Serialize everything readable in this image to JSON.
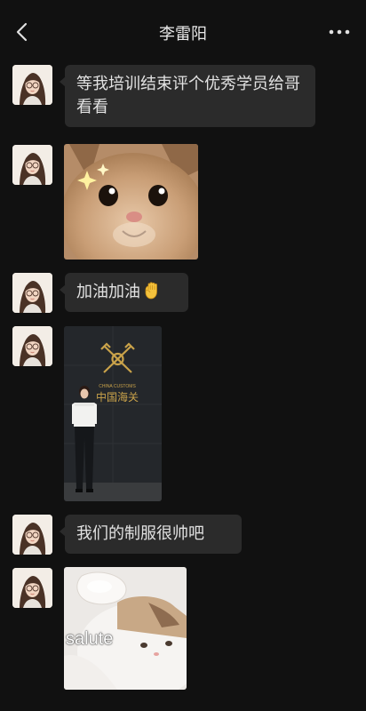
{
  "header": {
    "title": "李雷阳",
    "back_icon": "chevron-left-icon",
    "more_icon": "more-horizontal-icon"
  },
  "messages": [
    {
      "type": "text",
      "sender": "contact",
      "text": "等我培训结束评个优秀学员给哥看看"
    },
    {
      "type": "image",
      "sender": "contact",
      "content": "smiling-cat-sticker"
    },
    {
      "type": "text",
      "sender": "contact",
      "text": "加油加油",
      "emoji": "raised-fist-icon"
    },
    {
      "type": "image",
      "sender": "contact",
      "content": "customs-officer-photo",
      "sign_text_en": "CHINA CUSTOMS",
      "sign_text_cn": "中国海关"
    },
    {
      "type": "text",
      "sender": "contact",
      "text": "我们的制服很帅吧"
    },
    {
      "type": "image",
      "sender": "contact",
      "content": "salute-cat-sticker",
      "overlay_text": "salute"
    }
  ],
  "colors": {
    "background": "#111111",
    "bubble": "#2b2b2b",
    "text": "#e2e2e2"
  }
}
